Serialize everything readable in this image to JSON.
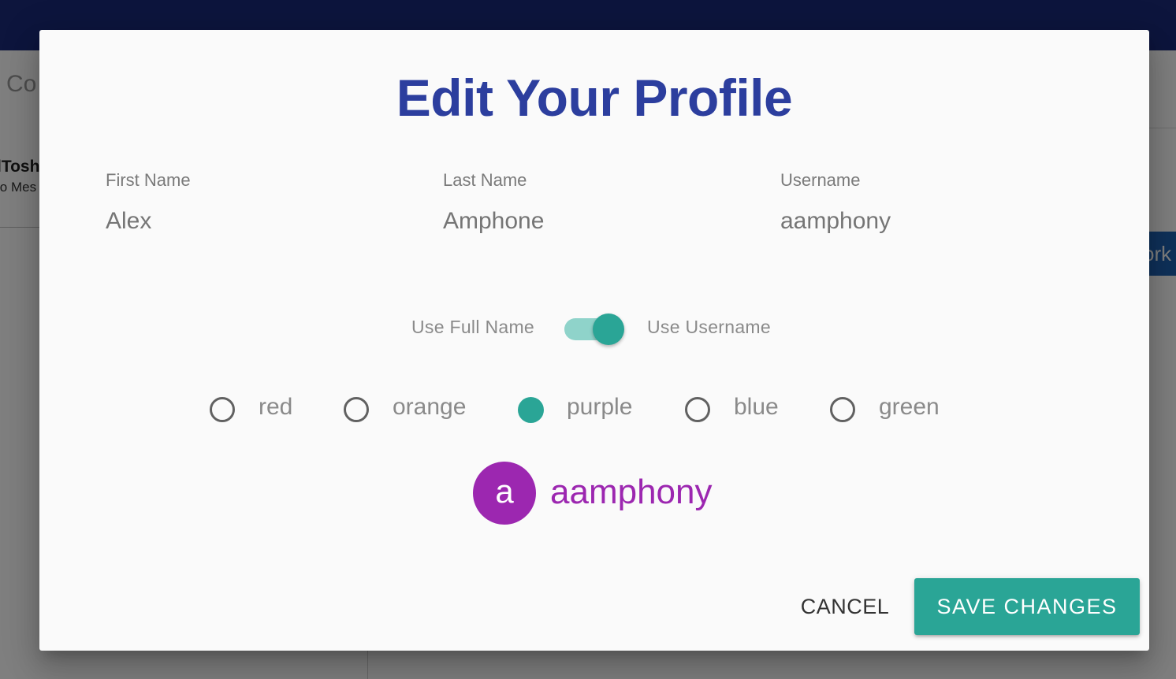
{
  "background": {
    "header_title": "Co",
    "contact_name": "lTosh",
    "contact_message": "lo Mes",
    "right_button_label": "ork"
  },
  "dialog": {
    "title": "Edit Your Profile",
    "fields": {
      "first_name": {
        "label": "First Name",
        "placeholder": "Alex"
      },
      "last_name": {
        "label": "Last Name",
        "placeholder": "Amphone"
      },
      "username": {
        "label": "Username",
        "placeholder": "aamphony"
      }
    },
    "display_toggle": {
      "left_label": "Use Full Name",
      "right_label": "Use Username",
      "checked": true
    },
    "colors": [
      {
        "label": "red",
        "checked": false
      },
      {
        "label": "orange",
        "checked": false
      },
      {
        "label": "purple",
        "checked": true
      },
      {
        "label": "blue",
        "checked": false
      },
      {
        "label": "green",
        "checked": false
      }
    ],
    "preview": {
      "avatar_letter": "a",
      "display_name": "aamphony",
      "color": "#9c27b0"
    },
    "actions": {
      "cancel_label": "CANCEL",
      "save_label": "SAVE CHANGES"
    }
  },
  "theme": {
    "title_color": "#2c3e9e",
    "accent_color": "#2aa596",
    "topbar_color": "#1a2a7a"
  }
}
